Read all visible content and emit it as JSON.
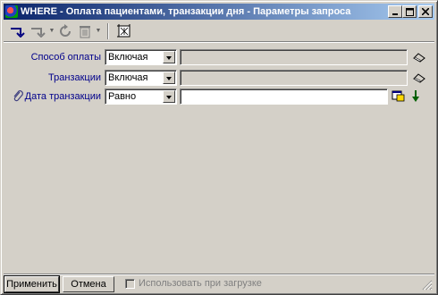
{
  "window": {
    "title": "WHERE - Оплата пациентами, транзакции дня - Параметры запроса",
    "controls": [
      "minimize-icon",
      "maximize-icon",
      "close-icon"
    ]
  },
  "toolbar": {
    "items": [
      "insert-arrow-icon",
      "remove-arrow-icon",
      "refresh-icon",
      "trash-icon",
      "query-designer-icon"
    ]
  },
  "fields": [
    {
      "label": "Способ оплаты",
      "operator": "Включая",
      "value": "",
      "value_enabled": false,
      "action_icon": "eraser-icon"
    },
    {
      "label": "Транзакции",
      "operator": "Включая",
      "value": "",
      "value_enabled": false,
      "action_icon": "eraser-icon"
    },
    {
      "label": "Дата транзакции",
      "operator": "Равно",
      "value": "",
      "value_enabled": true,
      "action_icon": "calendar-lookup-icon",
      "extra_icon": "down-arrow-icon",
      "prefix_icon": "paperclip-icon"
    }
  ],
  "bottom": {
    "apply_label": "Применить",
    "cancel_label": "Отмена",
    "use_on_load_label": "Использовать при загрузке",
    "use_on_load_checked": false
  },
  "colors": {
    "title_gradient_start": "#0a246a",
    "title_gradient_end": "#a6caf0",
    "label": "#00008b",
    "face": "#d4d0c8"
  }
}
